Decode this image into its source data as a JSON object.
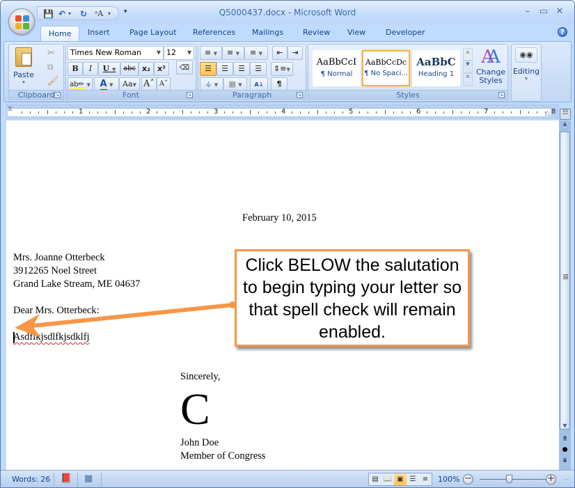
{
  "window": {
    "title": "Q5000437.docx - Microsoft Word"
  },
  "quick_access": {
    "icons": [
      "save-icon",
      "undo-icon",
      "redo-icon",
      "spelling-a-icon",
      "customize-icon"
    ]
  },
  "tabs": [
    {
      "label": "Home",
      "active": true
    },
    {
      "label": "Insert"
    },
    {
      "label": "Page Layout"
    },
    {
      "label": "References"
    },
    {
      "label": "Mailings"
    },
    {
      "label": "Review"
    },
    {
      "label": "View"
    },
    {
      "label": "Developer"
    }
  ],
  "ribbon": {
    "clipboard": {
      "label": "Clipboard",
      "paste": "Paste"
    },
    "font": {
      "label": "Font",
      "font_name": "Times New Roman",
      "font_size": "12",
      "bold": "B",
      "italic": "I",
      "underline": "U",
      "strike": "abc",
      "subscript": "x₂",
      "superscript": "x²",
      "change_case": "Aa",
      "grow": "A˄",
      "shrink": "A˅",
      "highlight_color": "#ffff00",
      "font_color": "#ff0000"
    },
    "paragraph": {
      "label": "Paragraph",
      "pilcrow": "¶"
    },
    "styles": {
      "label": "Styles",
      "items": [
        {
          "sample": "AaBbCcI",
          "name": "¶ Normal"
        },
        {
          "sample": "AaBbCcDc",
          "name": "¶ No Spaci...",
          "selected": true
        },
        {
          "sample": "AaBbC",
          "name": "Heading 1"
        }
      ],
      "change_styles": "Change Styles"
    },
    "editing": {
      "label": "Editing"
    }
  },
  "ruler": {
    "numbers": [
      "1",
      "2",
      "3",
      "4",
      "5",
      "6",
      "7",
      "8"
    ]
  },
  "document": {
    "date": "February 10, 2015",
    "address": [
      "Mrs. Joanne Otterbeck",
      "3912265 Noel Street",
      "Grand Lake Stream, ME  04637"
    ],
    "salutation": "Dear Mrs. Otterbeck:",
    "typed": "Asdflkjsdlfkjsdklfj",
    "closing": "Sincerely,",
    "signature": "C",
    "name": "John Doe",
    "title": "Member of Congress"
  },
  "callout": {
    "text": "Click BELOW the salutation to begin typing your letter so that spell check will remain enabled.",
    "color": "#f79646"
  },
  "status": {
    "words": "Words: 26",
    "zoom": "100%",
    "zoom_minus": "−",
    "zoom_plus": "+"
  }
}
